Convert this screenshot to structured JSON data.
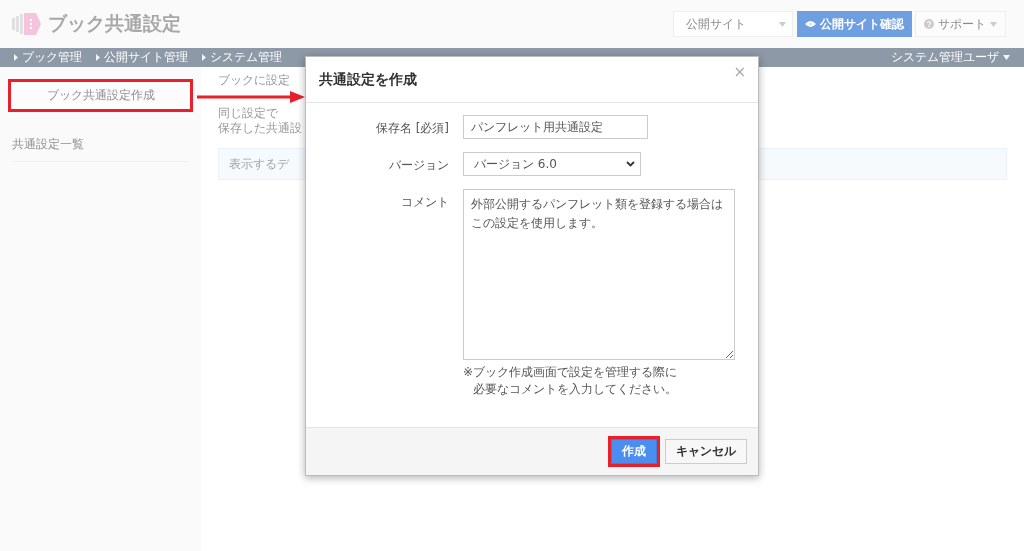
{
  "app": {
    "title": "ブック共通設定"
  },
  "header": {
    "site_select": "公開サイト",
    "view_site_button": "公開サイト確認",
    "support_menu": "サポート"
  },
  "nav": {
    "items": [
      "ブック管理",
      "公開サイト管理",
      "システム管理"
    ],
    "user_menu": "システム管理ユーザ"
  },
  "sidebar": {
    "create_button": {
      "label": "ブック共通設定作成",
      "highlighted": true
    },
    "section_title": "共通設定一覧"
  },
  "main": {
    "intro_lines": [
      "ブックに設定",
      "同じ設定で",
      "保存した共通設"
    ],
    "notice": "表示するデ"
  },
  "dialog": {
    "title": "共通設定を作成",
    "close": "×",
    "fields": [
      {
        "kind": "text",
        "label": "保存名 [必須]",
        "value": "パンフレット用共通設定"
      },
      {
        "kind": "select",
        "label": "バージョン",
        "value": "バージョン 6.0"
      },
      {
        "kind": "textarea",
        "label": "コメント",
        "value": "外部公開するパンフレット類を登録する場合はこの設定を使用します。",
        "hint_lines": [
          "※ブック作成画面で設定を管理する際に",
          "必要なコメントを入力してください。"
        ]
      }
    ],
    "buttons": [
      {
        "kind": "primary",
        "label": "作成",
        "highlighted": true
      },
      {
        "kind": "default",
        "label": "キャンセル",
        "highlighted": false
      }
    ]
  }
}
